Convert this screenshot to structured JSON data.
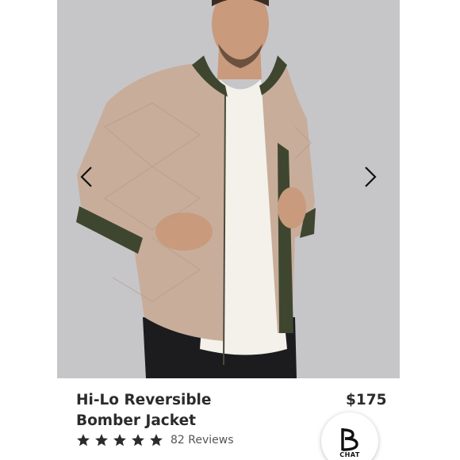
{
  "product": {
    "title_line1": "Hi-Lo Reversible",
    "title_line2": "Bomber Jacket",
    "price": "$175",
    "rating": 5,
    "rating_max": 5,
    "reviews_label": "82 Reviews"
  },
  "carousel": {
    "prev_icon": "chevron-left-icon",
    "next_icon": "chevron-right-icon",
    "background_color": "#c6c6c8"
  },
  "chat": {
    "label": "CHAT",
    "icon": "b-logo-icon"
  },
  "colors": {
    "text": "#2b2b2b",
    "jacket": "#c8ad9b",
    "lining": "#3f4630",
    "star": "#2b2b2b"
  }
}
